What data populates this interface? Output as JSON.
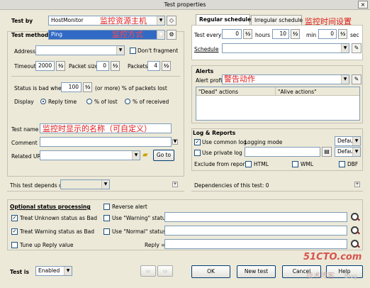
{
  "window": {
    "title": "Test properties",
    "close": "×"
  },
  "left": {
    "test_by_label": "Test by",
    "test_by_value": "HostMonitor",
    "test_method_label": "Test method",
    "test_method_value": "Ping",
    "address_label": "Address",
    "dont_fragment": "Don't fragment",
    "timeout_label": "Timeout",
    "timeout_value": "2000",
    "packet_size_label": "Packet size",
    "packet_size_value": "0",
    "packets_label": "Packets",
    "packets_value": "4",
    "status_bad_label": "Status is bad when",
    "status_bad_value": "100",
    "status_bad_suffix": "(or more) % of packets lost",
    "display_label": "Display",
    "radio_reply": "Reply time",
    "radio_lost": "% of lost",
    "radio_received": "% of received",
    "test_name_label": "Test name",
    "comment_label": "Comment",
    "related_url_label": "Related URL",
    "goto": "Go to",
    "depends_label": "This test depends on",
    "optional_label": "Optional status processing",
    "reverse_alert": "Reverse alert",
    "treat_unknown": "Treat Unknown status as Bad",
    "use_warning": "Use \"Warning\" status if",
    "treat_warning": "Treat Warning status as Bad",
    "use_normal": "Use \"Normal\" status if",
    "tune_reply": "Tune up Reply value",
    "reply_eq": "Reply =",
    "test_is_label": "Test is",
    "test_is_value": "Enabled"
  },
  "right": {
    "tab_regular": "Regular schedule",
    "tab_irregular": "Irregular schedule",
    "test_every_label": "Test every",
    "hours_value": "0",
    "hours_label": "hours",
    "min_value": "10",
    "min_label": "min",
    "sec_value": "0",
    "sec_label": "sec",
    "schedule_label": "Schedule",
    "alerts_label": "Alerts",
    "alert_profile_label": "Alert profile",
    "dead_actions": "\"Dead\" actions",
    "alive_actions": "\"Alive actions\"",
    "log_label": "Log & Reports",
    "use_common_log": "Use common log",
    "logging_mode": "Logging mode",
    "default1": "Default",
    "use_private_log": "Use private log",
    "default2": "Default",
    "exclude_label": "Exclude from reports:",
    "html": "HTML",
    "wml": "WML",
    "dbf": "DBF",
    "dependencies": "Dependencies of this test: 0"
  },
  "buttons": {
    "ok": "OK",
    "new_test": "New test",
    "cancel": "Cancel",
    "help": "Help"
  },
  "annotations": {
    "host": "监控资源主机",
    "method": "监控方式",
    "time": "监控时间设置",
    "alert": "警告动作",
    "name": "监控时显示的名称（可自定义）"
  },
  "watermark": {
    "brand": "51CTO.com",
    "sub": "技术博客",
    "tag": "Blog"
  }
}
